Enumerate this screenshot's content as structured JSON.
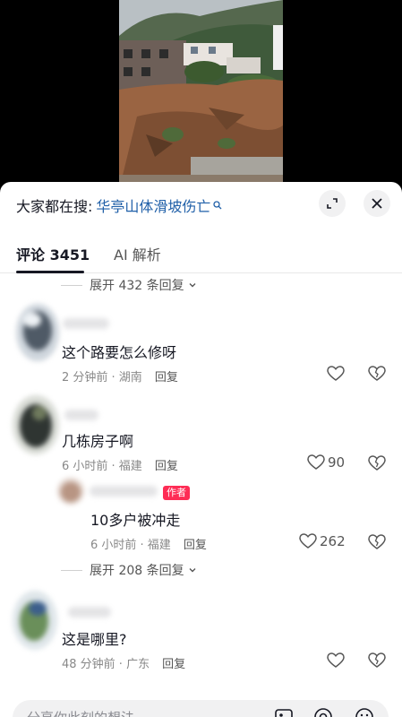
{
  "search": {
    "prefix": "大家都在搜:",
    "term": "华亭山体滑坡伤亡"
  },
  "tabs": [
    {
      "label": "评论 3451",
      "active": true
    },
    {
      "label": "AI 解析",
      "active": false
    }
  ],
  "expand_top": "展开 432 条回复",
  "comments": [
    {
      "text": "这个路要怎么修呀",
      "time_loc": "2 分钟前 · 湖南",
      "reply": "回复",
      "likes": ""
    },
    {
      "text": "几栋房子啊",
      "time_loc": "6 小时前 · 福建",
      "reply": "回复",
      "likes": "90"
    },
    {
      "text": "10多户被冲走",
      "time_loc": "6 小时前 · 福建",
      "reply": "回复",
      "likes": "262",
      "badge": "作者"
    },
    {
      "text": "这是哪里?",
      "time_loc": "48 分钟前 · 广东",
      "reply": "回复",
      "likes": ""
    }
  ],
  "expand_mid": "展开 208 条回复",
  "input": {
    "placeholder": "分享你此刻的想法"
  },
  "icons": [
    "expand-icon",
    "close-icon",
    "heart-icon",
    "broken-heart-icon",
    "image-icon",
    "at-icon",
    "emoji-icon"
  ],
  "colors": {
    "accent": "#1f5fa8",
    "author_badge": "#fe2c55"
  }
}
